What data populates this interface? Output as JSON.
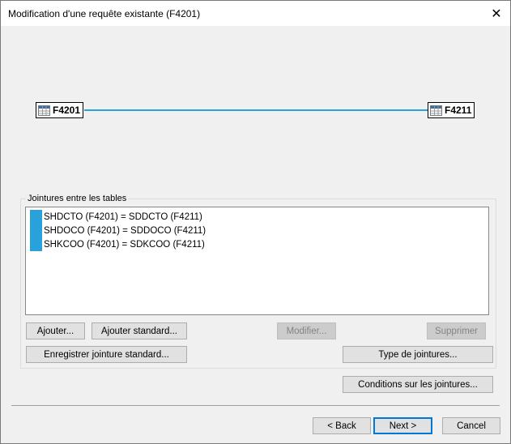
{
  "window": {
    "title": "Modification d'une requête existante (F4201)",
    "close_glyph": "✕"
  },
  "diagram": {
    "tables": [
      {
        "name": "F4201",
        "icon": "table-icon"
      },
      {
        "name": "F4211",
        "icon": "table-icon"
      }
    ],
    "link_color": "#29a1db"
  },
  "joins_group": {
    "label": "Jointures entre les tables",
    "items": [
      {
        "text": "SHDCTO (F4201) = SDDCTO (F4211)"
      },
      {
        "text": "SHDOCO (F4201) = SDDOCO (F4211)"
      },
      {
        "text": "SHKCOO (F4201) = SDKCOO (F4211)"
      }
    ],
    "buttons": {
      "add": "Ajouter...",
      "add_standard": "Ajouter standard...",
      "modify": "Modifier...",
      "delete": "Supprimer",
      "save_standard": "Enregistrer jointure standard...",
      "join_type": "Type de jointures..."
    }
  },
  "conditions_button": "Conditions sur les jointures...",
  "footer": {
    "back": "< Back",
    "next": "Next >",
    "cancel": "Cancel"
  }
}
